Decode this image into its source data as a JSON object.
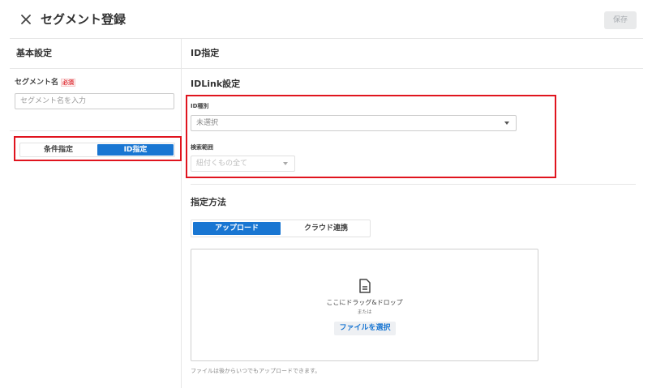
{
  "header": {
    "title": "セグメント登録",
    "save_label": "保存"
  },
  "left": {
    "section_title": "基本設定",
    "segment_name_label": "セグメント名",
    "required_badge": "必須",
    "segment_name_placeholder": "セグメント名を入力",
    "segment_name_value": "",
    "mode_options": [
      "条件指定",
      "ID指定"
    ],
    "mode_selected": "ID指定"
  },
  "right": {
    "section_title": "ID指定",
    "idlink": {
      "title": "IDLink設定",
      "id_type_label": "ID種別",
      "id_type_value": "未選択",
      "search_scope_label": "検索範囲",
      "search_scope_value": "紐付くもの全て"
    },
    "method": {
      "title": "指定方法",
      "options": [
        "アップロード",
        "クラウド連携"
      ],
      "selected": "アップロード"
    },
    "upload": {
      "drop_text": "ここにドラッグ&ドロップ",
      "or_text": "または",
      "choose_label": "ファイルを選択",
      "hint": "ファイルは後からいつでもアップロードできます。"
    }
  },
  "colors": {
    "accent": "#1976d2",
    "highlight_box": "#e0141e",
    "required": "#e0383e"
  }
}
